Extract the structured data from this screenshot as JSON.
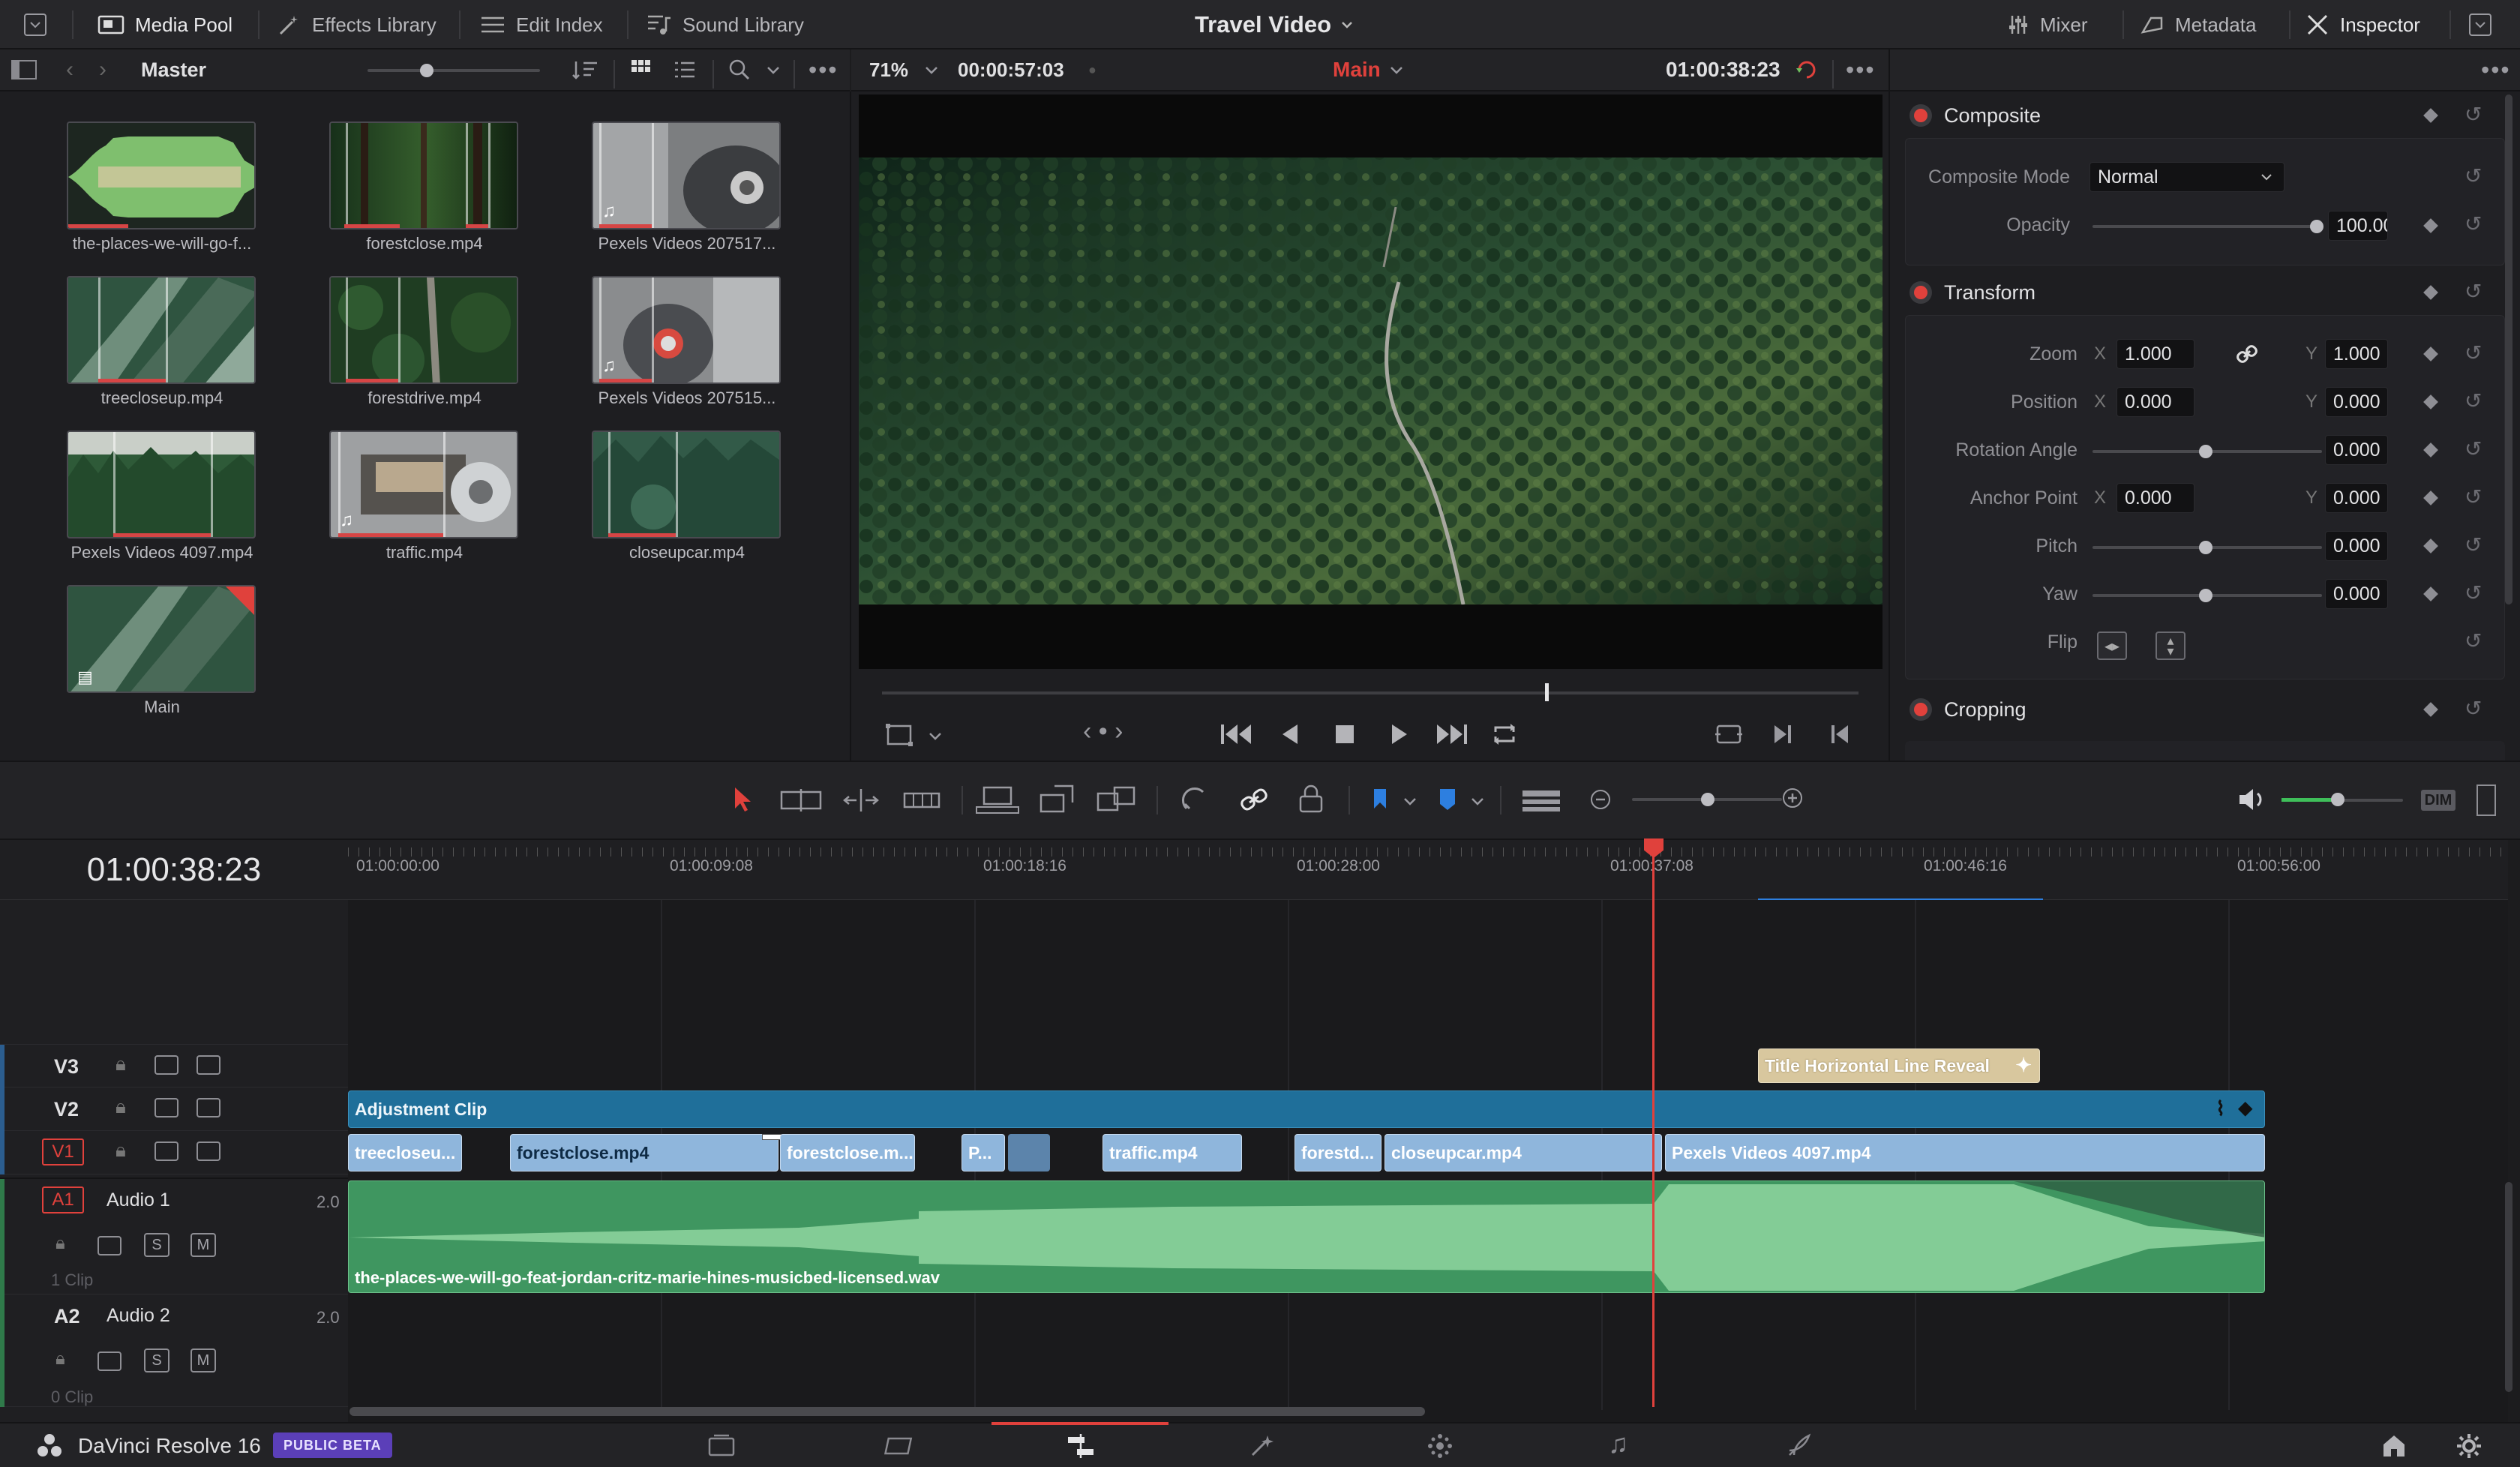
{
  "topbar": {
    "media_pool": "Media Pool",
    "effects_library": "Effects Library",
    "edit_index": "Edit Index",
    "sound_library": "Sound Library",
    "project_title": "Travel Video",
    "mixer": "Mixer",
    "metadata": "Metadata",
    "inspector": "Inspector"
  },
  "media_pool": {
    "bin_name": "Master",
    "clips": [
      {
        "name": "the-places-we-will-go-f..."
      },
      {
        "name": "forestclose.mp4"
      },
      {
        "name": "Pexels Videos 207517..."
      },
      {
        "name": "treecloseup.mp4"
      },
      {
        "name": "forestdrive.mp4"
      },
      {
        "name": "Pexels Videos 207515..."
      },
      {
        "name": "Pexels Videos 4097.mp4"
      },
      {
        "name": "traffic.mp4"
      },
      {
        "name": "closeupcar.mp4"
      },
      {
        "name": "Main"
      }
    ]
  },
  "viewer": {
    "zoom": "71%",
    "duration": "00:00:57:03",
    "timeline_name": "Main",
    "timecode": "01:00:38:23",
    "playhead_fraction": 0.68
  },
  "inspector": {
    "composite": {
      "title": "Composite",
      "mode_label": "Composite Mode",
      "mode_value": "Normal",
      "opacity_label": "Opacity",
      "opacity_value": "100.00"
    },
    "transform": {
      "title": "Transform",
      "zoom_label": "Zoom",
      "zoom_x": "1.000",
      "zoom_y": "1.000",
      "position_label": "Position",
      "position_x": "0.000",
      "position_y": "0.000",
      "rotation_label": "Rotation Angle",
      "rotation_value": "0.000",
      "anchor_label": "Anchor Point",
      "anchor_x": "0.000",
      "anchor_y": "0.000",
      "pitch_label": "Pitch",
      "pitch_value": "0.000",
      "yaw_label": "Yaw",
      "yaw_value": "0.000",
      "flip_label": "Flip",
      "x_label": "X",
      "y_label": "Y"
    },
    "cropping": {
      "title": "Cropping"
    }
  },
  "timeline": {
    "timecode": "01:00:38:23",
    "ruler": [
      "01:00:00:00",
      "01:00:09:08",
      "01:00:18:16",
      "01:00:28:00",
      "01:00:37:08",
      "01:00:46:16",
      "01:00:56:00"
    ],
    "tracks": {
      "v3": "V3",
      "v2": "V2",
      "v1": "V1",
      "a1": "A1",
      "a1_name": "Audio 1",
      "a1_channels": "2.0",
      "a1_count": "1 Clip",
      "a2": "A2",
      "a2_name": "Audio 2",
      "a2_channels": "2.0",
      "a2_count": "0 Clip",
      "solo": "S",
      "mute": "M"
    },
    "clips": {
      "title": "Title Horizontal Line Reveal",
      "adjustment": "Adjustment Clip",
      "v1": [
        "treecloseu...",
        "forestclose.mp4",
        "forestclose.m...",
        "P...",
        "traffic.mp4",
        "forestd...",
        "closeupcar.mp4",
        "Pexels Videos 4097.mp4"
      ],
      "audio": "the-places-we-will-go-feat-jordan-critz-marie-hines-musicbed-licensed.wav"
    },
    "dim": "DIM"
  },
  "bottombar": {
    "app_name": "DaVinci Resolve 16",
    "badge": "PUBLIC BETA"
  },
  "colors": {
    "accent_red": "#e0413c",
    "clip_blue": "#8fb6dc",
    "adjustment_blue": "#1f6f9a",
    "audio_green": "#3f9660"
  }
}
